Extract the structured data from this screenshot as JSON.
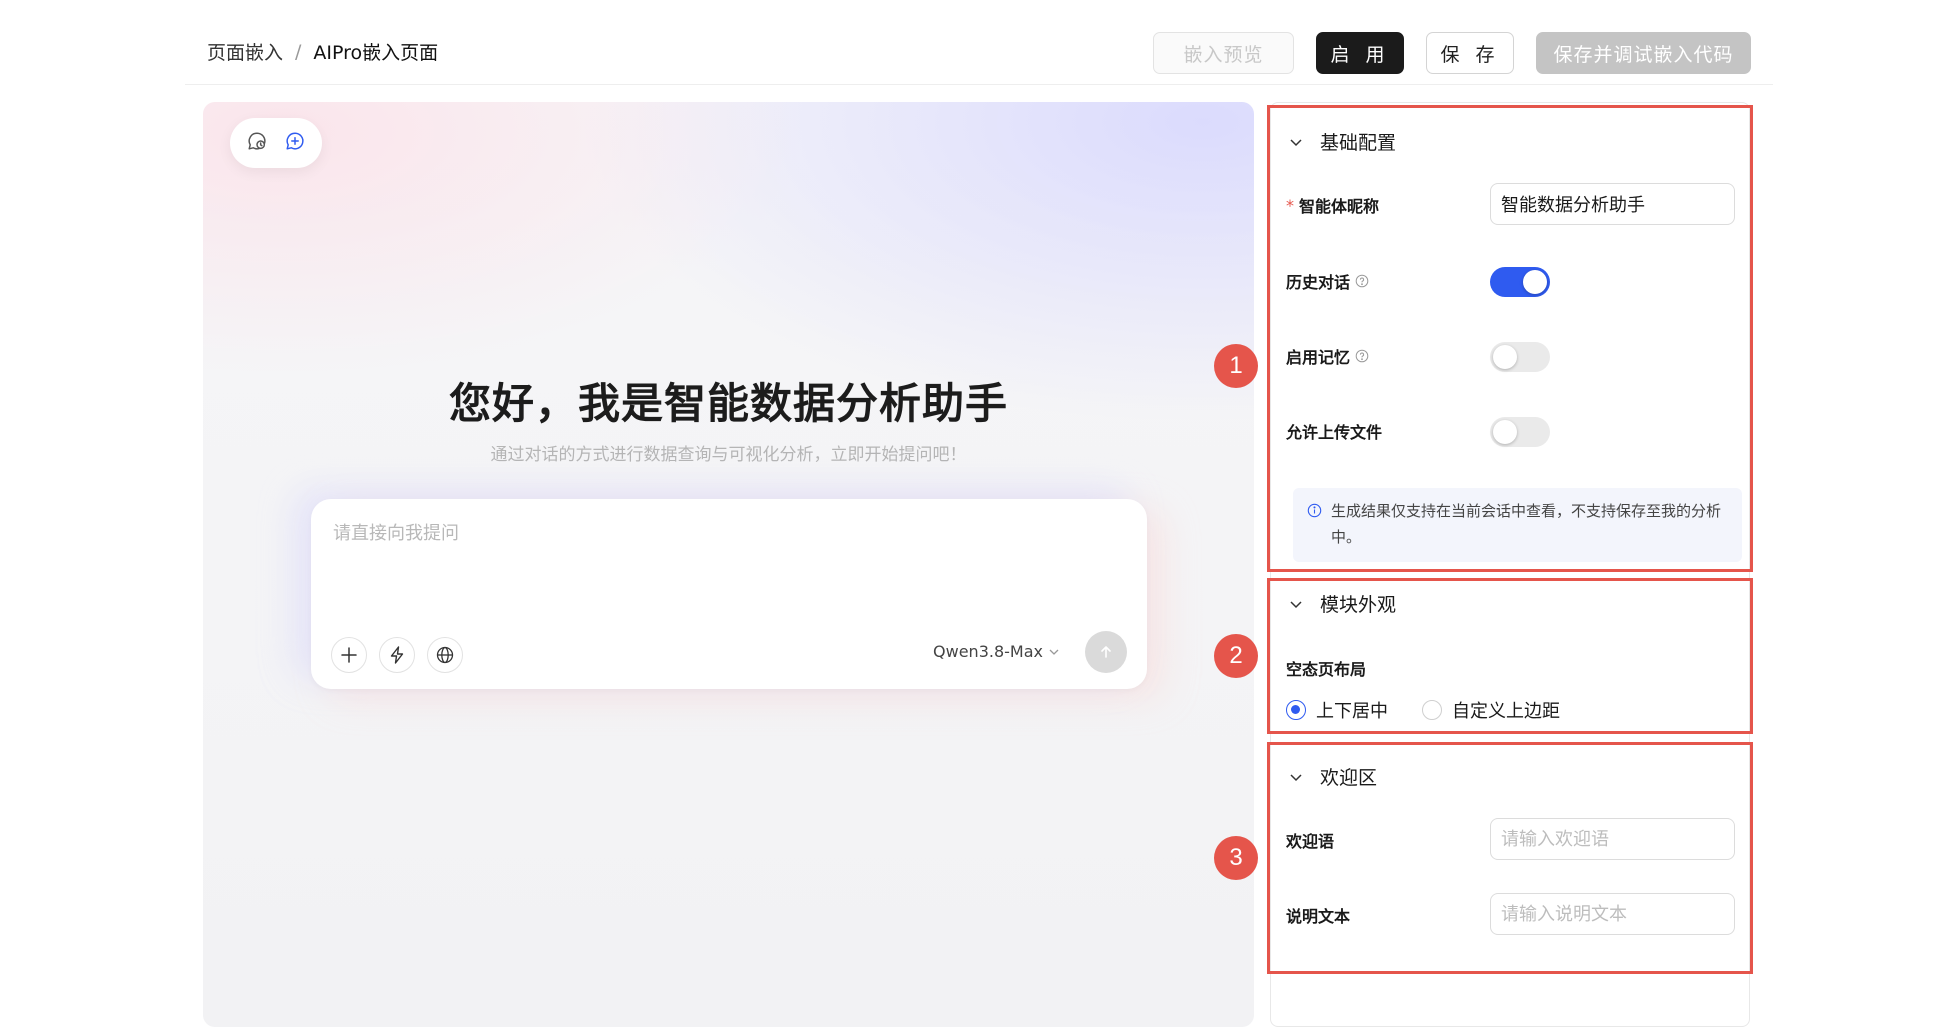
{
  "breadcrumb": {
    "parent": "页面嵌入",
    "separator": "/",
    "current": "AIPro嵌入页面"
  },
  "actions": {
    "preview_label": "嵌入预览",
    "enable_label": "启 用",
    "save_label": "保 存",
    "save_debug_label": "保存并调试嵌入代码"
  },
  "preview": {
    "mini_toolbar": {
      "history_icon": "history-chat-icon",
      "new_chat_icon": "new-chat-icon"
    },
    "title": "您好，我是智能数据分析助手",
    "subtitle": "通过对话的方式进行数据查询与可视化分析，立即开始提问吧！",
    "chat": {
      "placeholder": "请直接向我提问",
      "tools": [
        "plus-icon",
        "lightning-icon",
        "globe-icon"
      ],
      "model": "Qwen3.8-Max",
      "send_icon": "arrow-up-icon"
    }
  },
  "config": {
    "sections": [
      {
        "badge": "1",
        "title": "基础配置"
      },
      {
        "badge": "2",
        "title": "模块外观"
      },
      {
        "badge": "3",
        "title": "欢迎区"
      }
    ],
    "basic": {
      "nickname_required": "*",
      "nickname_label": "智能体昵称",
      "nickname_value": "智能数据分析助手",
      "history_label": "历史对话",
      "history_enabled": true,
      "memory_label": "启用记忆",
      "memory_enabled": false,
      "upload_label": "允许上传文件",
      "upload_enabled": false,
      "notice": "生成结果仅支持在当前会话中查看，不支持保存至我的分析中。"
    },
    "appearance": {
      "layout_label": "空态页布局",
      "options": [
        "上下居中",
        "自定义上边距"
      ],
      "selected": "上下居中"
    },
    "welcome": {
      "greeting_label": "欢迎语",
      "greeting_placeholder": "请输入欢迎语",
      "desc_label": "说明文本",
      "desc_placeholder": "请输入说明文本"
    }
  },
  "colors": {
    "accent": "#2f5bf0",
    "highlight": "#e5554b",
    "dark_button": "#1b1b1b"
  }
}
